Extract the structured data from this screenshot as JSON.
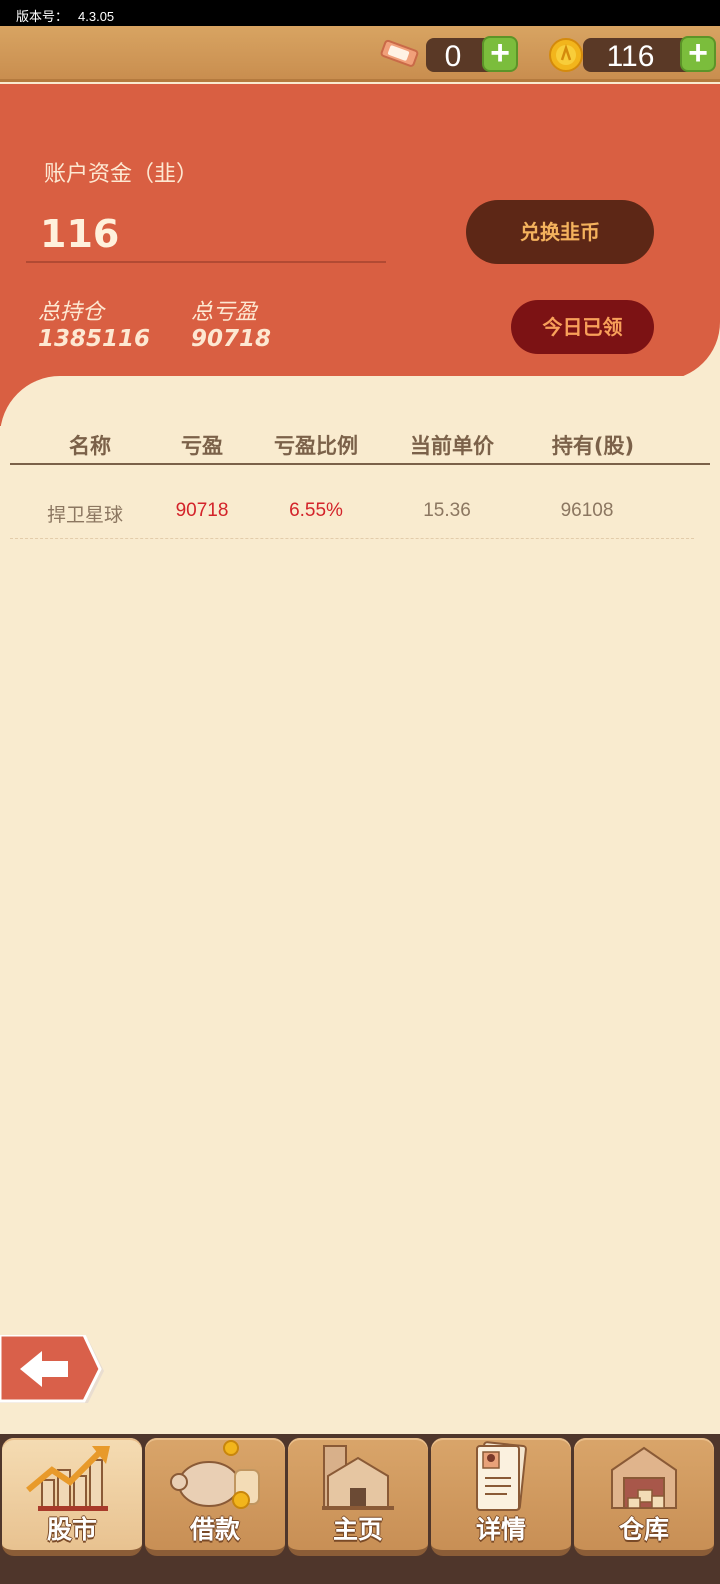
{
  "status_bar": {
    "version_label": "版本号：",
    "version": "4.3.05"
  },
  "top_bar": {
    "tickets": "0",
    "coins": "116"
  },
  "account": {
    "label": "账户资金（韭）",
    "value": "116",
    "total_position_label": "总持仓",
    "total_position": "1385116",
    "total_pnl_label": "总亏盈",
    "total_pnl": "90718",
    "exchange_button": "兑换韭币",
    "claim_button": "今日已领"
  },
  "table": {
    "headers": [
      "名称",
      "亏盈",
      "亏盈比例",
      "当前单价",
      "持有(股)"
    ],
    "rows": [
      {
        "name": "捍卫星球",
        "pnl": "90718",
        "ratio": "6.55%",
        "price": "15.36",
        "held": "96108"
      }
    ]
  },
  "nav": {
    "tabs": [
      {
        "label": "股市",
        "icon": "stock-chart-icon"
      },
      {
        "label": "借款",
        "icon": "piggy-bank-icon"
      },
      {
        "label": "主页",
        "icon": "house-icon"
      },
      {
        "label": "详情",
        "icon": "profile-document-icon"
      },
      {
        "label": "仓库",
        "icon": "warehouse-icon"
      }
    ]
  },
  "colors": {
    "accent_red": "#d95f42",
    "background": "#f9ebcf",
    "profit_red": "#d3232a"
  }
}
